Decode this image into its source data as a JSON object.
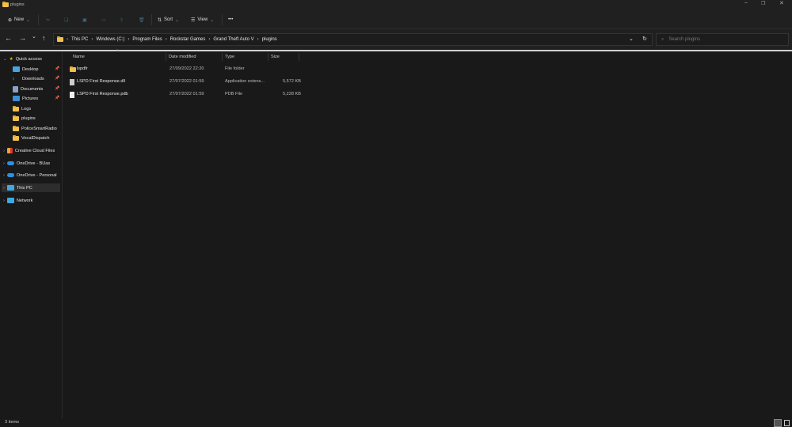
{
  "window": {
    "title": "plugins"
  },
  "toolbar": {
    "new_label": "New",
    "sort_label": "Sort",
    "view_label": "View",
    "more_label": "•••"
  },
  "address": {
    "breadcrumbs": [
      "This PC",
      "Windows (C:)",
      "Program Files",
      "Rockstar Games",
      "Grand Theft Auto V",
      "plugins"
    ],
    "search_placeholder": "Search plugins"
  },
  "sidebar": {
    "quick_access": "Quick access",
    "quick_items": [
      {
        "label": "Desktop",
        "pinned": true
      },
      {
        "label": "Downloads",
        "pinned": true
      },
      {
        "label": "Documents",
        "pinned": true
      },
      {
        "label": "Pictures",
        "pinned": true
      },
      {
        "label": "Logs"
      },
      {
        "label": "plugins"
      },
      {
        "label": "PoliceSmartRadio"
      },
      {
        "label": "VocalDispatch"
      }
    ],
    "roots": [
      "Creative Cloud Files",
      "OneDrive - BUas",
      "OneDrive - Personal",
      "This PC",
      "Network"
    ]
  },
  "columns": [
    "Name",
    "Date modified",
    "Type",
    "Size"
  ],
  "files": [
    {
      "name": "lspdfr",
      "date": "27/09/2022 22:20",
      "type": "File folder",
      "size": "",
      "kind": "folder"
    },
    {
      "name": "LSPD First Response.dll",
      "date": "27/07/2022 01:59",
      "type": "Application extens...",
      "size": "5,572 KB",
      "kind": "dll"
    },
    {
      "name": "LSPD First Response.pdb",
      "date": "27/07/2022 01:59",
      "type": "PDB File",
      "size": "5,228 KB",
      "kind": "file"
    }
  ],
  "status": {
    "count": "3 items"
  },
  "colors": {
    "accent": "#4cc2ff",
    "folder": "#f2c04c",
    "bg": "#191919"
  }
}
